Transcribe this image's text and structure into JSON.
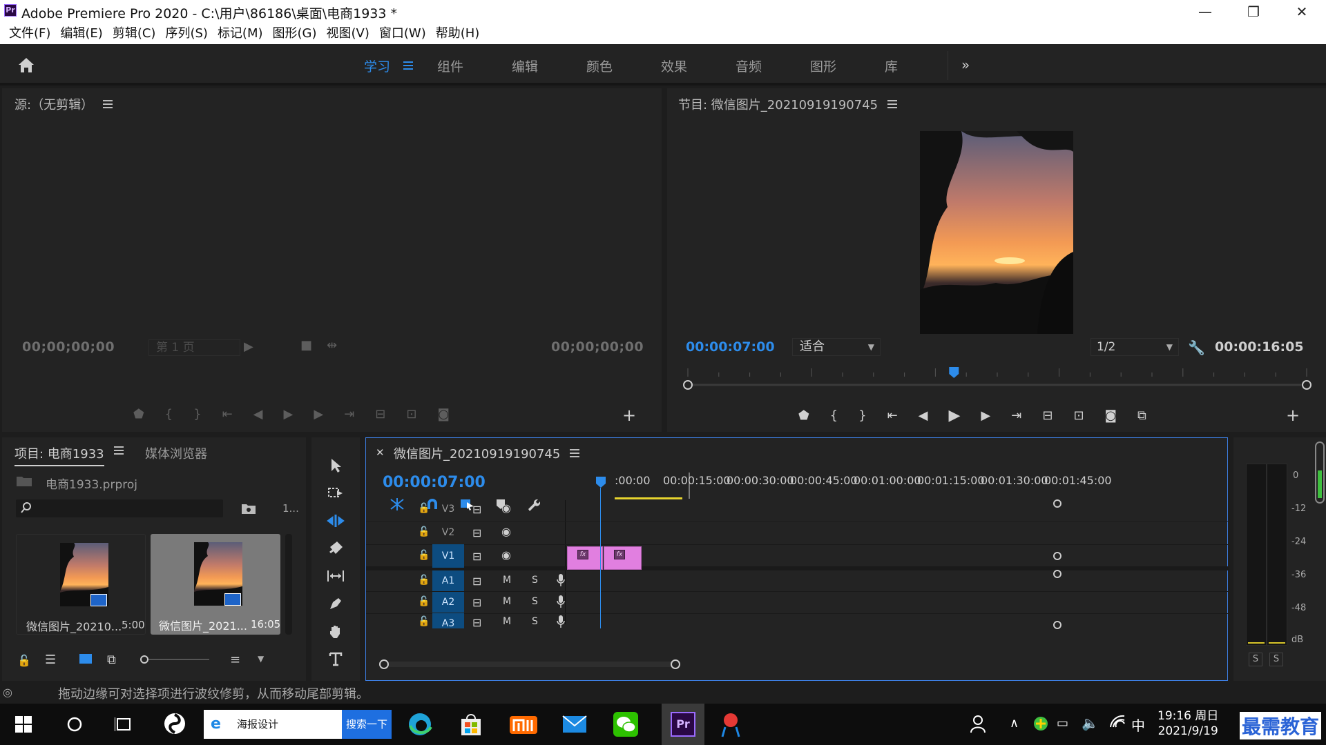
{
  "window": {
    "title": "Adobe Premiere Pro 2020 - C:\\用户\\86186\\桌面\\电商1933 *",
    "app_badge": "Pr",
    "minimize": "—",
    "restore": "❐",
    "close": "✕"
  },
  "menu": [
    "文件(F)",
    "编辑(E)",
    "剪辑(C)",
    "序列(S)",
    "标记(M)",
    "图形(G)",
    "视图(V)",
    "窗口(W)",
    "帮助(H)"
  ],
  "workspaces": {
    "tabs": [
      "学习",
      "组件",
      "编辑",
      "颜色",
      "效果",
      "音频",
      "图形",
      "库"
    ],
    "active": "学习",
    "more": "»"
  },
  "source": {
    "title": "源:（无剪辑）",
    "timecode_in": "00;00;00;00",
    "timecode_out": "00;00;00;00",
    "page": "第 1 页"
  },
  "program": {
    "title": "节目: 微信图片_20210919190745",
    "timecode": "00:00:07:00",
    "fit": "适合",
    "resolution": "1/2",
    "duration": "00:00:16:05",
    "playhead_fraction": 0.43
  },
  "project": {
    "tab_project": "项目: 电商1933",
    "tab_media": "媒体浏览器",
    "file": "电商1933.prproj",
    "count": "1...",
    "items": [
      {
        "name": "微信图片_20210...",
        "duration": "5:00"
      },
      {
        "name": "微信图片_2021...",
        "duration": "16:05"
      }
    ]
  },
  "timeline": {
    "sequence": "微信图片_20210919190745",
    "timecode": "00:00:07:00",
    "ruler_labels": [
      ":00:00",
      "00:00:15:00",
      "00:00:30:00",
      "00:00:45:00",
      "00:01:00:00",
      "00:01:15:00",
      "00:01:30:00",
      "00:01:45:00"
    ],
    "video_tracks": [
      "V3",
      "V2",
      "V1"
    ],
    "audio_tracks": [
      "A1",
      "A2",
      "A3"
    ],
    "track_m": "M",
    "track_s": "S",
    "fx": "fx"
  },
  "meter": {
    "scale": [
      "0",
      "-12",
      "-24",
      "-36",
      "-48",
      "dB"
    ],
    "solo": "S"
  },
  "status": {
    "hint": "拖动边缘可对选择项进行波纹修剪，从而移动尾部剪辑。"
  },
  "taskbar": {
    "search_text": "海报设计",
    "search_button": "搜索一下",
    "ime": "中",
    "time": "19:16 周日",
    "date": "2021/9/19",
    "brand": "最需教育"
  },
  "colors": {
    "accent": "#2d8ceb",
    "clip": "#e17fe0",
    "panel": "#232323",
    "track_active": "#0d4c80"
  }
}
